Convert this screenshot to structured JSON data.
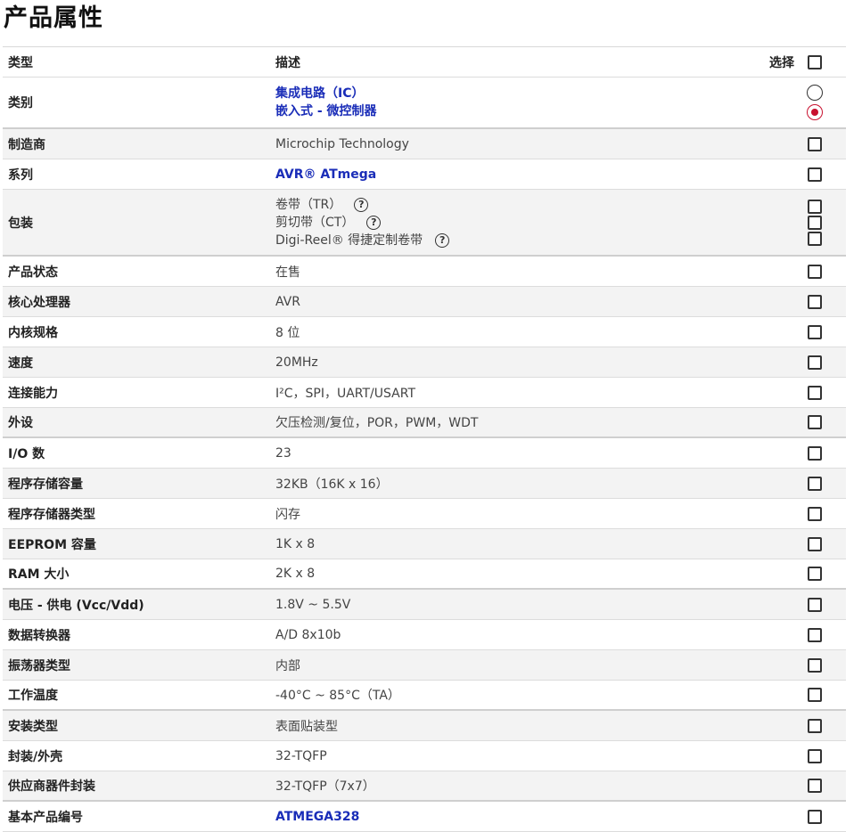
{
  "page": {
    "title": "产品属性"
  },
  "header": {
    "type": "类型",
    "desc": "描述",
    "select": "选择"
  },
  "rows": [
    {
      "type": "类别",
      "lines": [
        "集成电路（IC）",
        "嵌入式 - 微控制器"
      ],
      "link": true,
      "control": "radio",
      "selected": 1
    },
    {
      "type": "制造商",
      "value": "Microchip Technology"
    },
    {
      "type": "系列",
      "value": "AVR® ATmega",
      "link": true
    },
    {
      "type": "包装",
      "lines": [
        "卷带（TR）",
        "剪切带（CT）",
        "Digi-Reel® 得捷定制卷带"
      ],
      "help": true,
      "control": "multi"
    },
    {
      "type": "产品状态",
      "value": "在售"
    },
    {
      "type": "核心处理器",
      "value": "AVR"
    },
    {
      "type": "内核规格",
      "value": "8 位"
    },
    {
      "type": "速度",
      "value": "20MHz"
    },
    {
      "type": "连接能力",
      "value": "I²C，SPI，UART/USART"
    },
    {
      "type": "外设",
      "value": "欠压检测/复位，POR，PWM，WDT"
    },
    {
      "type": "I/O 数",
      "value": "23"
    },
    {
      "type": "程序存储容量",
      "value": "32KB（16K x 16）"
    },
    {
      "type": "程序存储器类型",
      "value": "闪存"
    },
    {
      "type": "EEPROM 容量",
      "value": "1K x 8"
    },
    {
      "type": "RAM 大小",
      "value": "2K x 8"
    },
    {
      "type": "电压 - 供电 (Vcc/Vdd)",
      "value": "1.8V ~ 5.5V"
    },
    {
      "type": "数据转换器",
      "value": "A/D 8x10b"
    },
    {
      "type": "振荡器类型",
      "value": "内部"
    },
    {
      "type": "工作温度",
      "value": "-40°C ~ 85°C（TA）"
    },
    {
      "type": "安装类型",
      "value": "表面贴装型"
    },
    {
      "type": "封装/外壳",
      "value": "32-TQFP"
    },
    {
      "type": "供应商器件封装",
      "value": "32-TQFP（7x7）"
    },
    {
      "type": "基本产品编号",
      "value": "ATMEGA328",
      "link": true
    }
  ],
  "help_icon": "question-circle-icon",
  "colors": {
    "link": "#1a2db8",
    "radio_selected": "#c8102e",
    "row_alt": "#f3f3f3"
  }
}
